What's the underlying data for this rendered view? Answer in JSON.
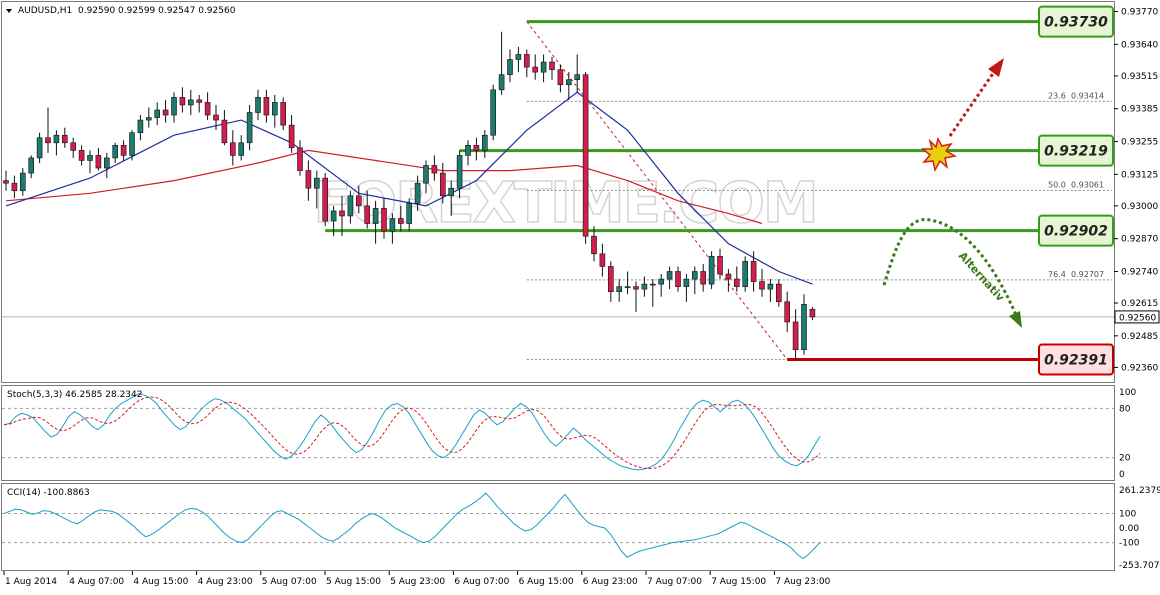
{
  "colors": {
    "bull": "#1e7a6e",
    "bear": "#d21e4e",
    "ma_fast": "#1c2fa0",
    "ma_slow": "#d0202a",
    "support_resistance": "#3a9a1a",
    "stop_level": "#c00000",
    "stoch_main": "#1aa0c8",
    "stoch_signal": "#d02020",
    "cci": "#1aa0c8",
    "grid": "#a8a8a8",
    "arrow_up": "#c01818",
    "arrow_alt": "#3a7a1a"
  },
  "icons": {
    "header_marker": "triangle-down-icon",
    "burst": "explosion-burst-icon"
  },
  "watermark": "FOREXTIME.COM",
  "main_header": "AUDUSD,H1  0.92590 0.92599 0.92547 0.92560",
  "stoch_header": "Stoch(5,3,3) 46.2585 28.2342",
  "cci_header": "CCI(14) -100.8863",
  "alternative_label": "Alternativ",
  "chart_data": [
    {
      "type": "candlestick",
      "symbol": "AUDUSD",
      "timeframe": "H1",
      "ohlc_last": {
        "open": 0.9259,
        "high": 0.92599,
        "low": 0.92547,
        "close": 0.9256
      },
      "ylim": [
        0.9231,
        0.938
      ],
      "y_ticks": [
        "0.93770",
        "0.93640",
        "0.93515",
        "0.93385",
        "0.93255",
        "0.93125",
        "0.93000",
        "0.92870",
        "0.92740",
        "0.92615",
        "0.92485",
        "0.92360"
      ],
      "current_price": "0.92560",
      "x_ticks": [
        "1 Aug 2014",
        "4 Aug 07:00",
        "4 Aug 15:00",
        "4 Aug 23:00",
        "5 Aug 07:00",
        "5 Aug 15:00",
        "5 Aug 23:00",
        "6 Aug 07:00",
        "6 Aug 15:00",
        "6 Aug 23:00",
        "7 Aug 07:00",
        "7 Aug 15:00",
        "7 Aug 23:00"
      ],
      "candles": [
        [
          0.931,
          0.9314,
          0.9306,
          0.9309
        ],
        [
          0.9309,
          0.9312,
          0.9303,
          0.9306
        ],
        [
          0.9306,
          0.9315,
          0.9304,
          0.9313
        ],
        [
          0.9313,
          0.932,
          0.9311,
          0.9319
        ],
        [
          0.9319,
          0.9329,
          0.9317,
          0.9327
        ],
        [
          0.9327,
          0.9339,
          0.9321,
          0.9325
        ],
        [
          0.9325,
          0.933,
          0.932,
          0.9328
        ],
        [
          0.9328,
          0.9331,
          0.9323,
          0.9325
        ],
        [
          0.9325,
          0.9327,
          0.9319,
          0.9322
        ],
        [
          0.9322,
          0.9324,
          0.9316,
          0.9318
        ],
        [
          0.9318,
          0.9322,
          0.9313,
          0.932
        ],
        [
          0.932,
          0.9323,
          0.9314,
          0.9315
        ],
        [
          0.9315,
          0.9321,
          0.9311,
          0.9319
        ],
        [
          0.9319,
          0.9325,
          0.9317,
          0.9324
        ],
        [
          0.9324,
          0.9326,
          0.9318,
          0.932
        ],
        [
          0.932,
          0.933,
          0.9318,
          0.9329
        ],
        [
          0.9329,
          0.9336,
          0.9326,
          0.9334
        ],
        [
          0.9334,
          0.9339,
          0.9331,
          0.9335
        ],
        [
          0.9335,
          0.9341,
          0.9332,
          0.9338
        ],
        [
          0.9338,
          0.9342,
          0.9333,
          0.9336
        ],
        [
          0.9336,
          0.9345,
          0.9333,
          0.9343
        ],
        [
          0.9343,
          0.9347,
          0.9337,
          0.934
        ],
        [
          0.934,
          0.9346,
          0.9336,
          0.9342
        ],
        [
          0.9342,
          0.9344,
          0.9337,
          0.9341
        ],
        [
          0.9341,
          0.9345,
          0.9334,
          0.9336
        ],
        [
          0.9336,
          0.934,
          0.933,
          0.9334
        ],
        [
          0.9334,
          0.9338,
          0.9324,
          0.9325
        ],
        [
          0.9325,
          0.933,
          0.9316,
          0.932
        ],
        [
          0.932,
          0.9328,
          0.9318,
          0.9325
        ],
        [
          0.9325,
          0.934,
          0.9322,
          0.9337
        ],
        [
          0.9337,
          0.9346,
          0.9334,
          0.9343
        ],
        [
          0.9343,
          0.9346,
          0.9333,
          0.9336
        ],
        [
          0.9336,
          0.9344,
          0.9331,
          0.9341
        ],
        [
          0.9341,
          0.9343,
          0.933,
          0.9332
        ],
        [
          0.9332,
          0.9336,
          0.9321,
          0.9323
        ],
        [
          0.9323,
          0.9326,
          0.9312,
          0.9314
        ],
        [
          0.9314,
          0.9318,
          0.9302,
          0.9307
        ],
        [
          0.9307,
          0.9314,
          0.9299,
          0.9311
        ],
        [
          0.9311,
          0.9313,
          0.9292,
          0.9294
        ],
        [
          0.9294,
          0.93,
          0.9288,
          0.9298
        ],
        [
          0.9298,
          0.9304,
          0.9288,
          0.9296
        ],
        [
          0.9296,
          0.9306,
          0.9293,
          0.9304
        ],
        [
          0.9304,
          0.9308,
          0.9297,
          0.93
        ],
        [
          0.93,
          0.9306,
          0.9291,
          0.9293
        ],
        [
          0.9293,
          0.9302,
          0.9285,
          0.9299
        ],
        [
          0.9299,
          0.9303,
          0.9287,
          0.929
        ],
        [
          0.929,
          0.9297,
          0.9285,
          0.9295
        ],
        [
          0.9295,
          0.93,
          0.929,
          0.9293
        ],
        [
          0.9293,
          0.9303,
          0.929,
          0.9301
        ],
        [
          0.9301,
          0.9312,
          0.9298,
          0.9309
        ],
        [
          0.9309,
          0.9318,
          0.9305,
          0.9316
        ],
        [
          0.9316,
          0.932,
          0.931,
          0.9313
        ],
        [
          0.9313,
          0.9317,
          0.9301,
          0.9304
        ],
        [
          0.9304,
          0.931,
          0.9296,
          0.9307
        ],
        [
          0.9307,
          0.9322,
          0.9303,
          0.932
        ],
        [
          0.932,
          0.9326,
          0.9316,
          0.9324
        ],
        [
          0.9324,
          0.9327,
          0.9318,
          0.9322
        ],
        [
          0.9322,
          0.933,
          0.9319,
          0.9328
        ],
        [
          0.9328,
          0.9348,
          0.9326,
          0.9346
        ],
        [
          0.9346,
          0.9369,
          0.9344,
          0.9352
        ],
        [
          0.9352,
          0.9362,
          0.9349,
          0.9358
        ],
        [
          0.9358,
          0.9363,
          0.9353,
          0.936
        ],
        [
          0.936,
          0.9362,
          0.9351,
          0.9355
        ],
        [
          0.9355,
          0.936,
          0.935,
          0.9353
        ],
        [
          0.9353,
          0.936,
          0.9349,
          0.9357
        ],
        [
          0.9357,
          0.9359,
          0.935,
          0.9354
        ],
        [
          0.9354,
          0.9356,
          0.9345,
          0.9348
        ],
        [
          0.9348,
          0.9353,
          0.9342,
          0.935
        ],
        [
          0.935,
          0.936,
          0.9345,
          0.9352
        ],
        [
          0.9352,
          0.9353,
          0.9285,
          0.9288
        ],
        [
          0.9288,
          0.9292,
          0.9278,
          0.9281
        ],
        [
          0.9281,
          0.9285,
          0.9272,
          0.9276
        ],
        [
          0.9276,
          0.9278,
          0.9262,
          0.9266
        ],
        [
          0.9266,
          0.9271,
          0.9262,
          0.9268
        ],
        [
          0.9268,
          0.9274,
          0.9265,
          0.9268
        ],
        [
          0.9268,
          0.927,
          0.9258,
          0.9267
        ],
        [
          0.9267,
          0.9272,
          0.9264,
          0.9269
        ],
        [
          0.9269,
          0.9271,
          0.926,
          0.9269
        ],
        [
          0.9269,
          0.9273,
          0.9264,
          0.9271
        ],
        [
          0.9271,
          0.9276,
          0.9267,
          0.9274
        ],
        [
          0.9274,
          0.9276,
          0.9266,
          0.9268
        ],
        [
          0.9268,
          0.9273,
          0.9262,
          0.9271
        ],
        [
          0.9271,
          0.9276,
          0.9265,
          0.9274
        ],
        [
          0.9274,
          0.9277,
          0.9266,
          0.9269
        ],
        [
          0.9269,
          0.9282,
          0.9267,
          0.928
        ],
        [
          0.928,
          0.9283,
          0.9271,
          0.9273
        ],
        [
          0.9273,
          0.9275,
          0.9266,
          0.9271
        ],
        [
          0.9271,
          0.9276,
          0.9266,
          0.9268
        ],
        [
          0.9268,
          0.928,
          0.9266,
          0.9278
        ],
        [
          0.9278,
          0.9282,
          0.9266,
          0.927
        ],
        [
          0.927,
          0.9275,
          0.9264,
          0.9267
        ],
        [
          0.9267,
          0.9271,
          0.9262,
          0.9269
        ],
        [
          0.9269,
          0.9271,
          0.926,
          0.9262
        ],
        [
          0.9262,
          0.9266,
          0.925,
          0.9254
        ],
        [
          0.9254,
          0.9259,
          0.9239,
          0.9243
        ],
        [
          0.9243,
          0.9265,
          0.9241,
          0.9261
        ],
        [
          0.9259,
          0.926,
          0.92547,
          0.9256
        ]
      ],
      "ma_fast": [
        [
          0,
          0.93
        ],
        [
          10,
          0.9311
        ],
        [
          20,
          0.9328
        ],
        [
          28,
          0.9334
        ],
        [
          34,
          0.9325
        ],
        [
          42,
          0.9305
        ],
        [
          50,
          0.93
        ],
        [
          56,
          0.931
        ],
        [
          62,
          0.933
        ],
        [
          68,
          0.9345
        ],
        [
          74,
          0.933
        ],
        [
          80,
          0.9305
        ],
        [
          86,
          0.9285
        ],
        [
          92,
          0.9274
        ],
        [
          96,
          0.9269
        ]
      ],
      "ma_slow": [
        [
          0,
          0.9302
        ],
        [
          10,
          0.9305
        ],
        [
          20,
          0.931
        ],
        [
          30,
          0.9317
        ],
        [
          36,
          0.9322
        ],
        [
          44,
          0.9318
        ],
        [
          52,
          0.9314
        ],
        [
          60,
          0.9314
        ],
        [
          68,
          0.9316
        ],
        [
          74,
          0.931
        ],
        [
          80,
          0.9302
        ],
        [
          86,
          0.9297
        ],
        [
          90,
          0.9293
        ]
      ],
      "levels": [
        {
          "label": "0.93730",
          "value": 0.9373,
          "x_from": 62,
          "role": "resistance"
        },
        {
          "label": "0.93219",
          "value": 0.93219,
          "x_from": 54,
          "role": "resistance"
        },
        {
          "label": "0.92902",
          "value": 0.92902,
          "x_from": 38,
          "role": "support"
        },
        {
          "label": "0.92391",
          "value": 0.92391,
          "x_from": 93,
          "role": "low"
        }
      ],
      "fibonacci": [
        {
          "ratio": "23.6",
          "label": "0.93414",
          "value": 0.93414
        },
        {
          "ratio": "50.0",
          "label": "0.93061",
          "value": 0.93061
        },
        {
          "ratio": "76.4",
          "label": "0.92707",
          "value": 0.92707
        }
      ]
    },
    {
      "type": "line",
      "name": "Stoch(5,3,3)",
      "main": 46.2585,
      "signal": 28.2342,
      "ylim": [
        0,
        100
      ],
      "y_ticks": [
        "100",
        "80",
        "20",
        "0"
      ],
      "levels": [
        80,
        20
      ],
      "main_values": [
        60,
        62,
        70,
        74,
        72,
        68,
        60,
        52,
        45,
        48,
        58,
        70,
        76,
        72,
        66,
        58,
        54,
        60,
        72,
        80,
        86,
        90,
        94,
        98,
        96,
        92,
        86,
        76,
        68,
        60,
        54,
        58,
        66,
        74,
        82,
        88,
        92,
        90,
        86,
        80,
        74,
        68,
        60,
        52,
        44,
        36,
        28,
        22,
        18,
        22,
        30,
        40,
        52,
        64,
        72,
        66,
        58,
        48,
        40,
        32,
        26,
        30,
        40,
        52,
        66,
        78,
        84,
        86,
        82,
        74,
        62,
        50,
        38,
        28,
        22,
        20,
        26,
        36,
        48,
        60,
        72,
        78,
        74,
        66,
        60,
        64,
        72,
        80,
        86,
        82,
        74,
        62,
        50,
        40,
        34,
        40,
        48,
        56,
        50,
        42,
        36,
        30,
        24,
        18,
        14,
        10,
        8,
        6,
        5,
        6,
        8,
        12,
        18,
        28,
        40,
        54,
        66,
        78,
        86,
        90,
        88,
        82,
        76,
        82,
        88,
        90,
        86,
        78,
        68,
        56,
        44,
        32,
        22,
        16,
        12,
        10,
        14,
        22,
        34,
        46
      ]
    },
    {
      "type": "line",
      "name": "CCI(14)",
      "value": -100.8863,
      "ylim": [
        -253.7071,
        261.2379
      ],
      "y_ticks": [
        "261.2379",
        "100",
        "0.00",
        "-100",
        "-253.7071"
      ],
      "levels": [
        100,
        -100
      ],
      "values": [
        100,
        115,
        130,
        125,
        110,
        95,
        105,
        120,
        115,
        100,
        80,
        60,
        40,
        30,
        55,
        85,
        110,
        125,
        120,
        115,
        100,
        70,
        40,
        10,
        -30,
        -60,
        -45,
        -20,
        10,
        40,
        70,
        100,
        125,
        135,
        130,
        110,
        80,
        40,
        0,
        -40,
        -70,
        -90,
        -100,
        -80,
        -40,
        0,
        40,
        80,
        110,
        120,
        100,
        80,
        60,
        30,
        0,
        -30,
        -60,
        -80,
        -90,
        -70,
        -40,
        -10,
        30,
        60,
        85,
        100,
        85,
        60,
        30,
        0,
        -20,
        -40,
        -60,
        -85,
        -100,
        -90,
        -60,
        -20,
        20,
        60,
        100,
        130,
        150,
        175,
        205,
        240,
        200,
        150,
        110,
        70,
        30,
        0,
        -20,
        -10,
        20,
        60,
        100,
        140,
        190,
        230,
        180,
        130,
        80,
        40,
        20,
        10,
        0,
        -40,
        -100,
        -160,
        -200,
        -180,
        -160,
        -150,
        -140,
        -130,
        -120,
        -110,
        -100,
        -95,
        -90,
        -85,
        -80,
        -70,
        -60,
        -50,
        -40,
        -20,
        0,
        20,
        40,
        30,
        10,
        -10,
        -30,
        -50,
        -70,
        -90,
        -110,
        -140,
        -180,
        -210,
        -180,
        -140,
        -100
      ]
    }
  ]
}
